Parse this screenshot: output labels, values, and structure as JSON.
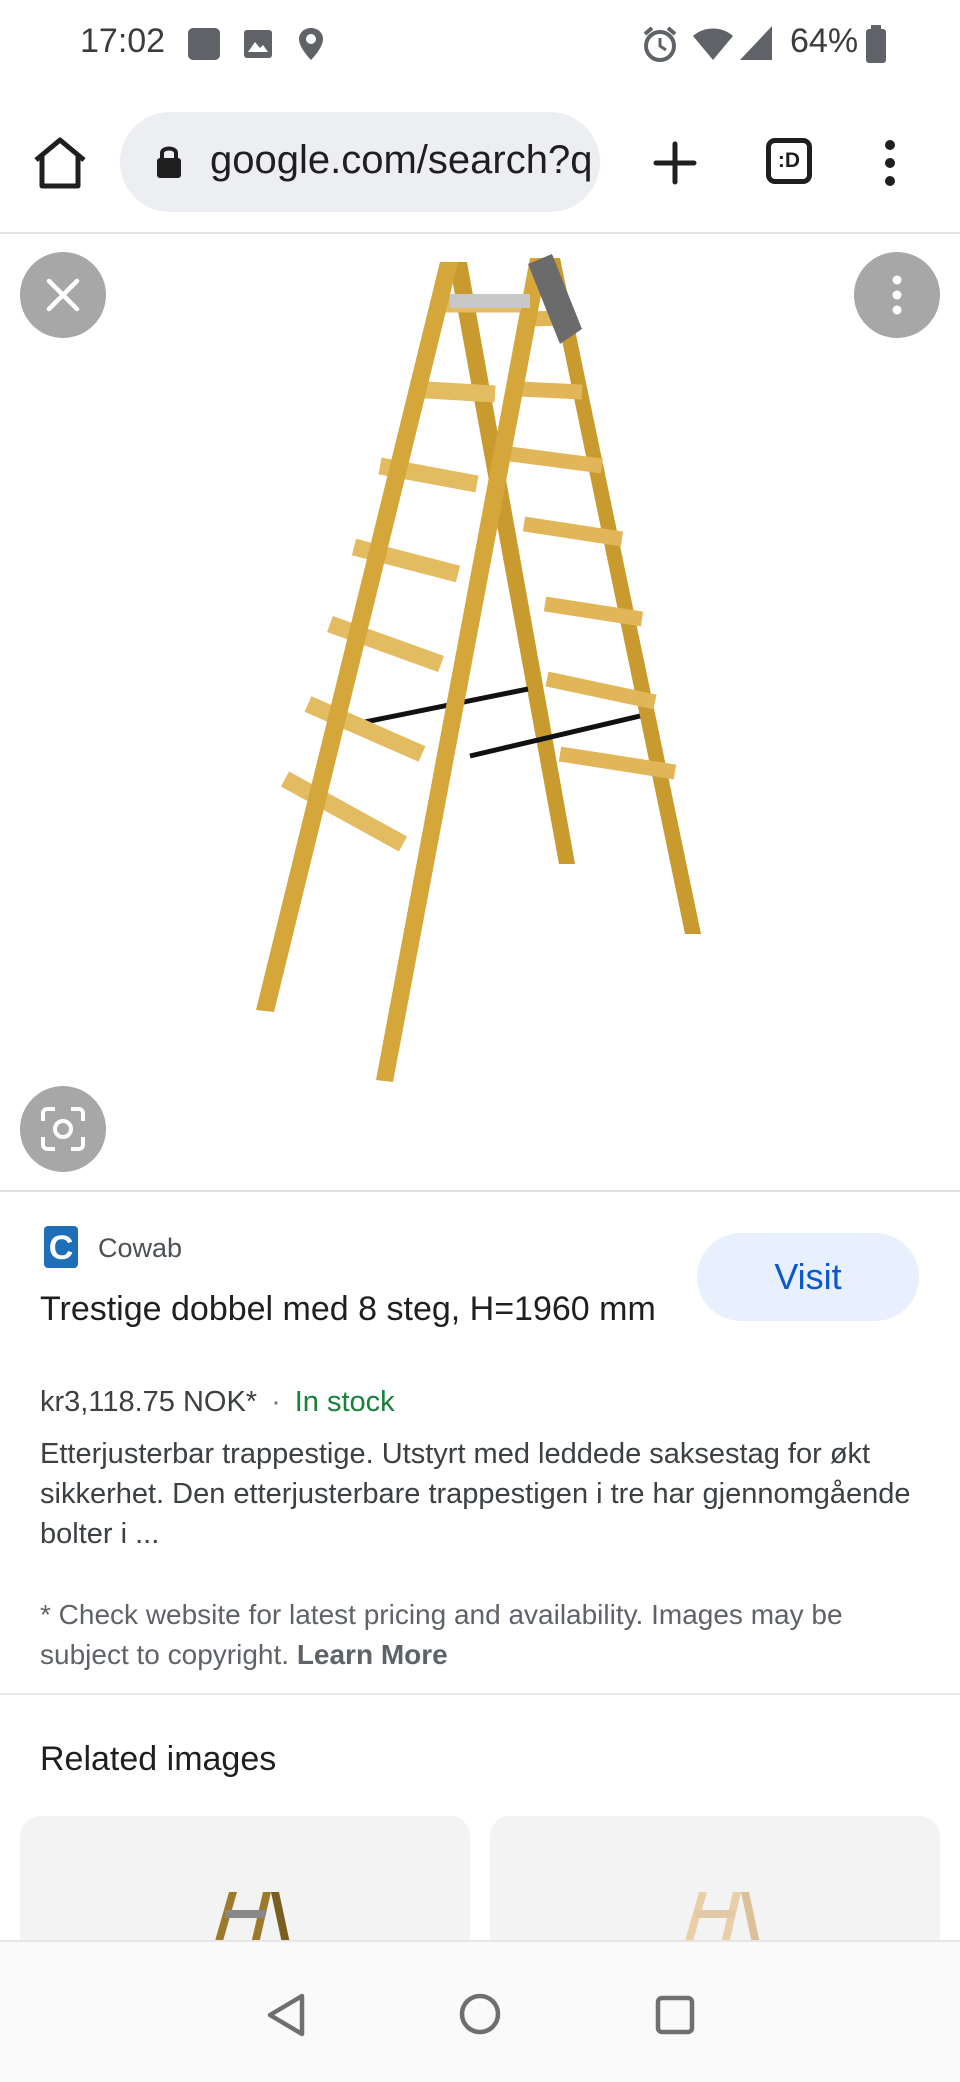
{
  "status_bar": {
    "time": "17:02",
    "battery": "64%",
    "left_icons": [
      "app-notification-icon",
      "image-icon",
      "location-icon"
    ],
    "right_icons": [
      "alarm-icon",
      "wifi-icon",
      "signal-icon",
      "battery-icon"
    ]
  },
  "browser": {
    "url": "google.com/search?q",
    "tab_count_label": ":D"
  },
  "result": {
    "source": "Cowab",
    "source_logo_letter": "C",
    "title": "Trestige dobbel med 8 steg, H=1960 mm",
    "price": "kr3,118.75 NOK*",
    "separator": "·",
    "stock": "In stock",
    "visit_label": "Visit",
    "description": "Etterjusterbar trappestige. Utstyrt med leddede saksestag for økt sikkerhet. Den etterjusterbare trappestigen i tre har gjennomgående bolter i ...",
    "disclaimer": "* Check website for latest pricing and availability. Images may be subject to copyright.",
    "learn_more": "Learn More"
  },
  "related": {
    "title": "Related images"
  },
  "colors": {
    "accent": "#0b57d0",
    "visit_bg": "#e8f0fe",
    "stock_green": "#188038",
    "cowab_blue": "#1e6fb8"
  }
}
